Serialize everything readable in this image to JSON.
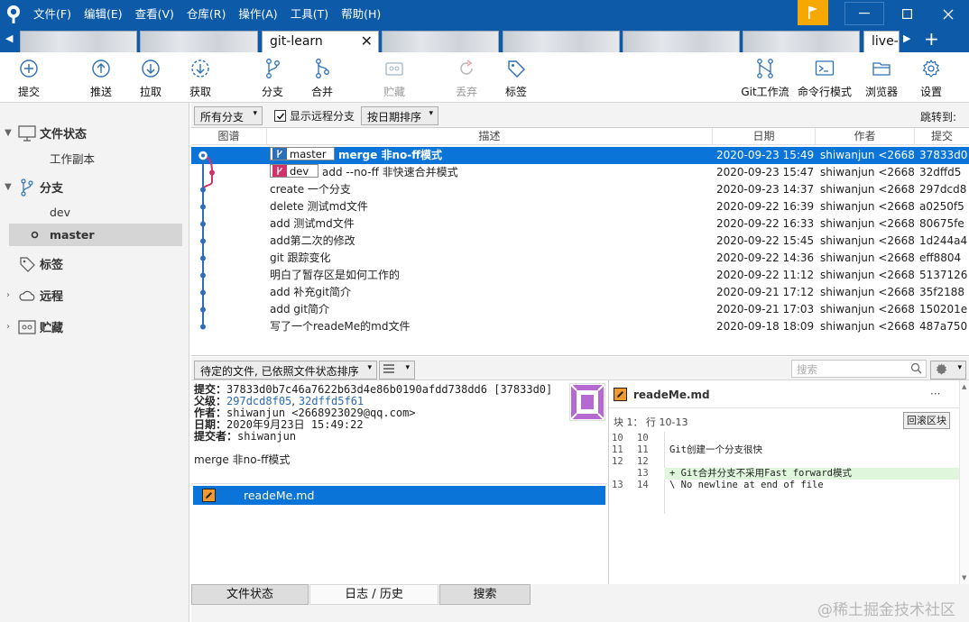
{
  "menu": {
    "file": "文件(F)",
    "edit": "编辑(E)",
    "view": "查看(V)",
    "repo": "仓库(R)",
    "action": "操作(A)",
    "tools": "工具(T)",
    "help": "帮助(H)"
  },
  "tabs": {
    "active": "git-learn",
    "partial": "live-"
  },
  "toolbar": {
    "commit": "提交",
    "push": "推送",
    "pull": "拉取",
    "fetch": "获取",
    "branch": "分支",
    "merge": "合并",
    "stash": "贮藏",
    "discard": "丢弃",
    "tag": "标签",
    "gitflow": "Git工作流",
    "terminal": "命令行模式",
    "explorer": "浏览器",
    "settings": "设置"
  },
  "sidebar": {
    "file_status": "文件状态",
    "working_copy": "工作副本",
    "branches": "分支",
    "branch_dev": "dev",
    "branch_master": "master",
    "tags": "标签",
    "remotes": "远程",
    "stashes": "贮藏"
  },
  "filter": {
    "all_branches": "所有分支",
    "show_remote": "显示远程分支",
    "sort": "按日期排序",
    "jump": "跳转到:"
  },
  "columns": {
    "graph": "图谱",
    "desc": "描述",
    "date": "日期",
    "author": "作者",
    "commit": "提交"
  },
  "commits": [
    {
      "branch": "master",
      "desc": "merge 非no-ff模式",
      "date": "2020-09-23 15:49",
      "author": "shiwanjun <2668",
      "hash": "37833d0"
    },
    {
      "branch": "dev",
      "desc": "add --no-ff 非快速合并模式",
      "date": "2020-09-23 15:47",
      "author": "shiwanjun <2668",
      "hash": "32dffd5"
    },
    {
      "branch": "",
      "desc": "create 一个分支",
      "date": "2020-09-23 14:37",
      "author": "shiwanjun <2668",
      "hash": "297dcd8"
    },
    {
      "branch": "",
      "desc": "delete 测试md文件",
      "date": "2020-09-22 16:39",
      "author": "shiwanjun <2668",
      "hash": "a0250f5"
    },
    {
      "branch": "",
      "desc": "add 测试md文件",
      "date": "2020-09-22 16:33",
      "author": "shiwanjun <2668",
      "hash": "80675fe"
    },
    {
      "branch": "",
      "desc": "add第二次的修改",
      "date": "2020-09-22 15:45",
      "author": "shiwanjun <2668",
      "hash": "1d244a4"
    },
    {
      "branch": "",
      "desc": "git 跟踪变化",
      "date": "2020-09-22 14:36",
      "author": "shiwanjun <2668",
      "hash": "eff8804"
    },
    {
      "branch": "",
      "desc": "明白了暂存区是如何工作的",
      "date": "2020-09-22 11:12",
      "author": "shiwanjun <2668",
      "hash": "5137126"
    },
    {
      "branch": "",
      "desc": "add 补充git简介",
      "date": "2020-09-21 17:12",
      "author": "shiwanjun <2668",
      "hash": "35f2188"
    },
    {
      "branch": "",
      "desc": "add git简介",
      "date": "2020-09-21 17:03",
      "author": "shiwanjun <2668",
      "hash": "150201e"
    },
    {
      "branch": "",
      "desc": "写了一个readeMe的md文件",
      "date": "2020-09-18 18:09",
      "author": "shiwanjun <2668",
      "hash": "487a750"
    }
  ],
  "lower": {
    "pending_sort": "待定的文件, 已依照文件状态排序",
    "search_placeholder": "搜索"
  },
  "detail": {
    "commit_label": "提交：",
    "commit_value": "37833d0b7c46a7622b63d4e86b0190afdd738dd6 [37833d0]",
    "parent_label": "父级：",
    "parent1": "297dcd8f05",
    "parent_sep": ", ",
    "parent2": "32dffd5f61",
    "author_label": "作者：",
    "author_value": "shiwanjun <2668923029@qq.com>",
    "date_label": "日期：",
    "date_value": "2020年9月23日 15:49:22",
    "committer_label": "提交者：",
    "committer_value": "shiwanjun",
    "message": "merge 非no-ff模式"
  },
  "files": [
    {
      "name": "readeMe.md"
    }
  ],
  "diff": {
    "filename": "readeMe.md",
    "more": "···",
    "hunk": "块 1： 行 10-13",
    "revert_hunk": "回滚区块",
    "lines": [
      {
        "old": "10",
        "new": "10",
        "text": ""
      },
      {
        "old": "11",
        "new": "11",
        "text": "  Git创建一个分支很快"
      },
      {
        "old": "12",
        "new": "12",
        "text": ""
      },
      {
        "old": "",
        "new": "13",
        "text": "+ Git合并分支不采用Fast forward模式"
      },
      {
        "old": "13",
        "new": "14",
        "text": "\\  No newline at end of file"
      }
    ]
  },
  "bottom_tabs": {
    "file_status": "文件状态",
    "log": "日志 / 历史",
    "search": "搜索"
  },
  "watermark": "@稀土掘金技术社区",
  "colors": {
    "titlebar": "#0c5aa8",
    "selection": "#0a74d8",
    "graph_blue": "#2c6fb8",
    "graph_pink": "#d0336a",
    "added_line": "#dff6dd",
    "flag": "#f5a800"
  }
}
